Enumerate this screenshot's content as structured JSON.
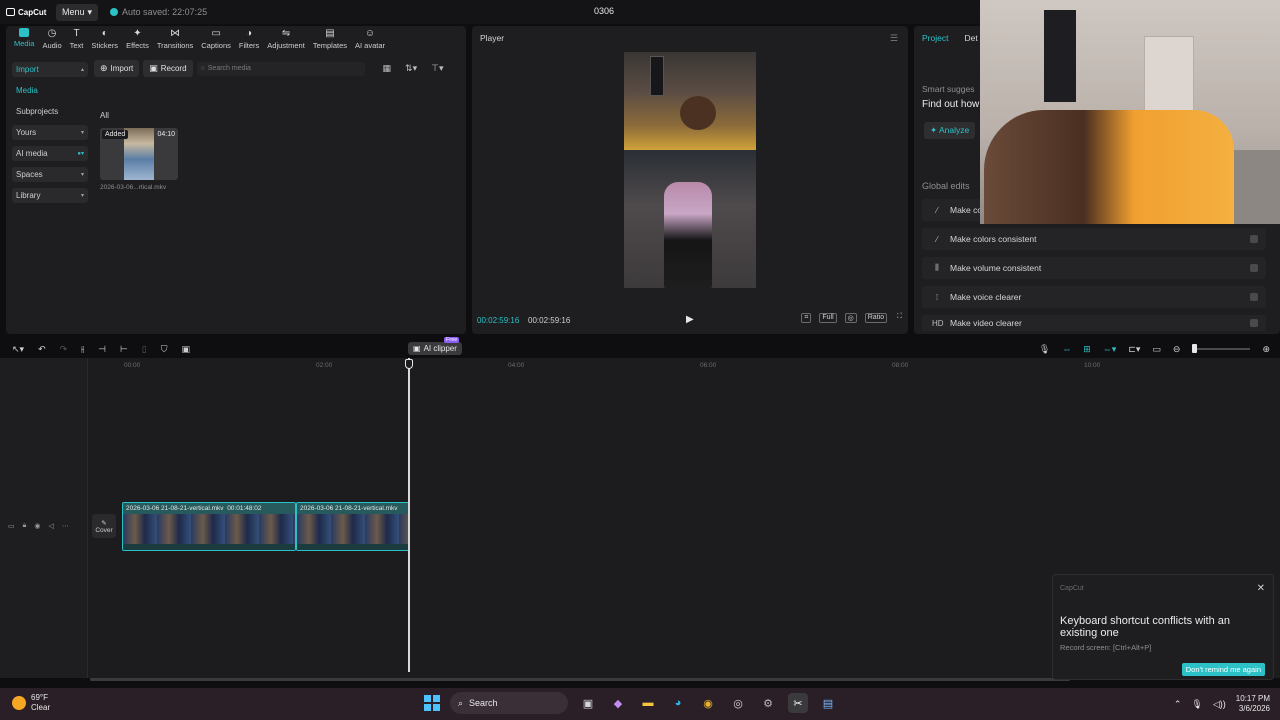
{
  "titlebar": {
    "app_name": "CapCut",
    "menu_label": "Menu",
    "autosave": "Auto saved: 22:07:25",
    "project_name": "0306"
  },
  "toolbar": {
    "items": [
      {
        "label": "Media",
        "icon": "media-icon",
        "active": true
      },
      {
        "label": "Audio",
        "icon": "audio-icon"
      },
      {
        "label": "Text",
        "icon": "text-icon"
      },
      {
        "label": "Stickers",
        "icon": "stickers-icon"
      },
      {
        "label": "Effects",
        "icon": "effects-icon"
      },
      {
        "label": "Transitions",
        "icon": "transitions-icon"
      },
      {
        "label": "Captions",
        "icon": "captions-icon"
      },
      {
        "label": "Filters",
        "icon": "filters-icon"
      },
      {
        "label": "Adjustment",
        "icon": "adjustment-icon"
      },
      {
        "label": "Templates",
        "icon": "templates-icon"
      },
      {
        "label": "AI avatar",
        "icon": "ai-avatar-icon"
      }
    ]
  },
  "leftnav": {
    "import": "Import",
    "media": "Media",
    "subprojects": "Subprojects",
    "yours": "Yours",
    "ai_media": "AI media",
    "spaces": "Spaces",
    "library": "Library"
  },
  "media": {
    "import_btn": "Import",
    "record_btn": "Record",
    "search_placeholder": "Search media",
    "filter_label": "All",
    "item": {
      "badge": "Added",
      "duration": "04:10",
      "name": "2026-03-06...rtical.mkv"
    },
    "ai_clipper": "AI clipper",
    "free_tag": "Free"
  },
  "player": {
    "title": "Player",
    "current_time": "00:02:59:16",
    "total_time": "00:02:59:16",
    "full_label": "Full",
    "ratio_label": "Ratio"
  },
  "rightpanel": {
    "tab_project": "Project",
    "tab_details": "Det",
    "smart_title": "Smart sugges",
    "smart_sub": "Find out how",
    "analyze": "Analyze",
    "global_title": "Global edits",
    "edits": [
      {
        "label": "Make co",
        "icon": "magic-wand-icon"
      },
      {
        "label": "Make colors consistent",
        "icon": "color-icon"
      },
      {
        "label": "Make volume consistent",
        "icon": "sliders-icon"
      },
      {
        "label": "Make voice clearer",
        "icon": "waveform-icon"
      },
      {
        "label": "Make video clearer",
        "icon": "hd-icon",
        "icon_text": "HD"
      }
    ]
  },
  "timeline": {
    "ticks": [
      "00:00",
      "02:00",
      "04:00",
      "06:00",
      "08:00",
      "10:00"
    ],
    "cover_label": "Cover",
    "clips": [
      {
        "name": "2026-03-06 21-08-21-vertical.mkv",
        "duration": "00:01:48:02"
      },
      {
        "name": "2026-03-06 21-08-21-vertical.mkv",
        "duration": ""
      }
    ]
  },
  "toast": {
    "app": "CapCut",
    "title": "Keyboard shortcut conflicts with an existing one",
    "sub": "Record screen: [Ctrl+Alt+P]",
    "button": "Don't remind me again"
  },
  "taskbar": {
    "temp": "69°F",
    "condition": "Clear",
    "search": "Search",
    "time": "10:17 PM",
    "date": "3/6/2026"
  },
  "colors": {
    "accent": "#2bc1c7",
    "panel": "#1e1e21",
    "background": "#0e0e10"
  }
}
